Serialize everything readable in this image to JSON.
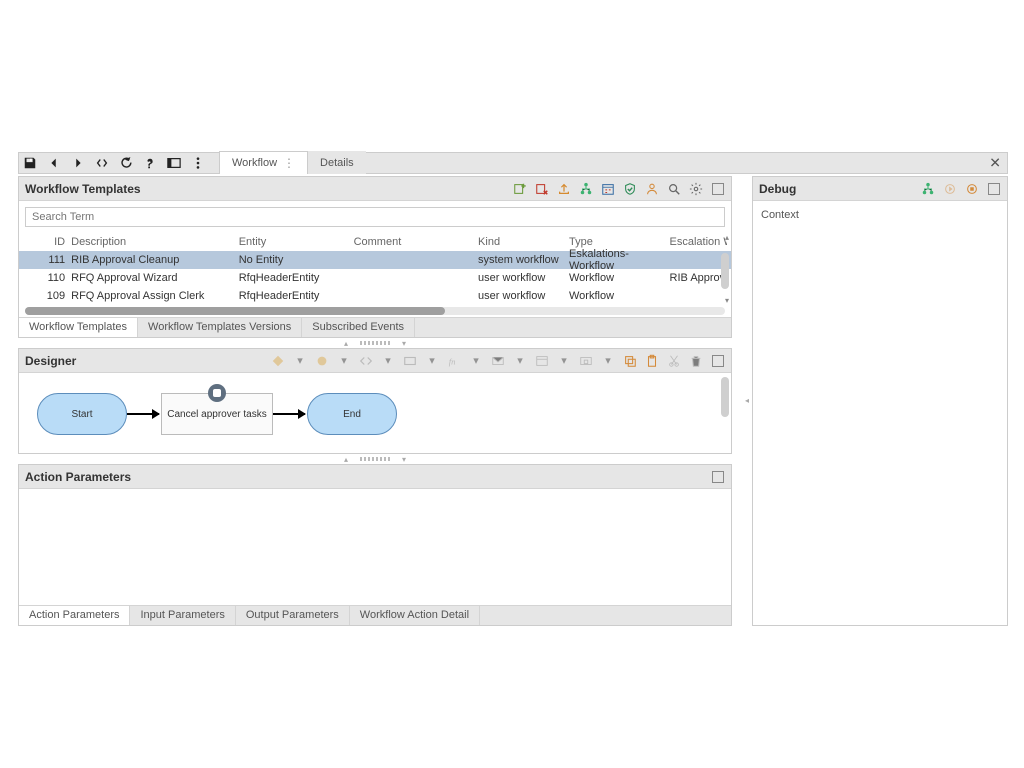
{
  "tabs": {
    "workflow": "Workflow",
    "details": "Details"
  },
  "workflow_templates": {
    "title": "Workflow Templates",
    "search_placeholder": "Search Term",
    "columns": {
      "id": "ID",
      "description": "Description",
      "entity": "Entity",
      "comment": "Comment",
      "kind": "Kind",
      "type": "Type",
      "escalation": "Escalation Wo"
    },
    "rows": [
      {
        "id": "111",
        "description": "RIB Approval Cleanup",
        "entity": "No Entity",
        "comment": "",
        "kind": "system workflow",
        "type": "Eskalations-Workflow",
        "escalation": ""
      },
      {
        "id": "110",
        "description": "RFQ Approval Wizard",
        "entity": "RfqHeaderEntity",
        "comment": "",
        "kind": "user workflow",
        "type": "Workflow",
        "escalation": "RIB Approv"
      },
      {
        "id": "109",
        "description": "RFQ Approval Assign Clerk",
        "entity": "RfqHeaderEntity",
        "comment": "",
        "kind": "user workflow",
        "type": "Workflow",
        "escalation": ""
      }
    ],
    "bottom_tabs": {
      "templates": "Workflow Templates",
      "versions": "Workflow Templates Versions",
      "subscribed": "Subscribed Events"
    }
  },
  "designer": {
    "title": "Designer",
    "start": "Start",
    "task": "Cancel approver tasks",
    "end": "End"
  },
  "action_parameters": {
    "title": "Action Parameters",
    "bottom_tabs": {
      "action": "Action Parameters",
      "input": "Input Parameters",
      "output": "Output Parameters",
      "detail": "Workflow Action Detail"
    }
  },
  "debug": {
    "title": "Debug",
    "context": "Context"
  }
}
